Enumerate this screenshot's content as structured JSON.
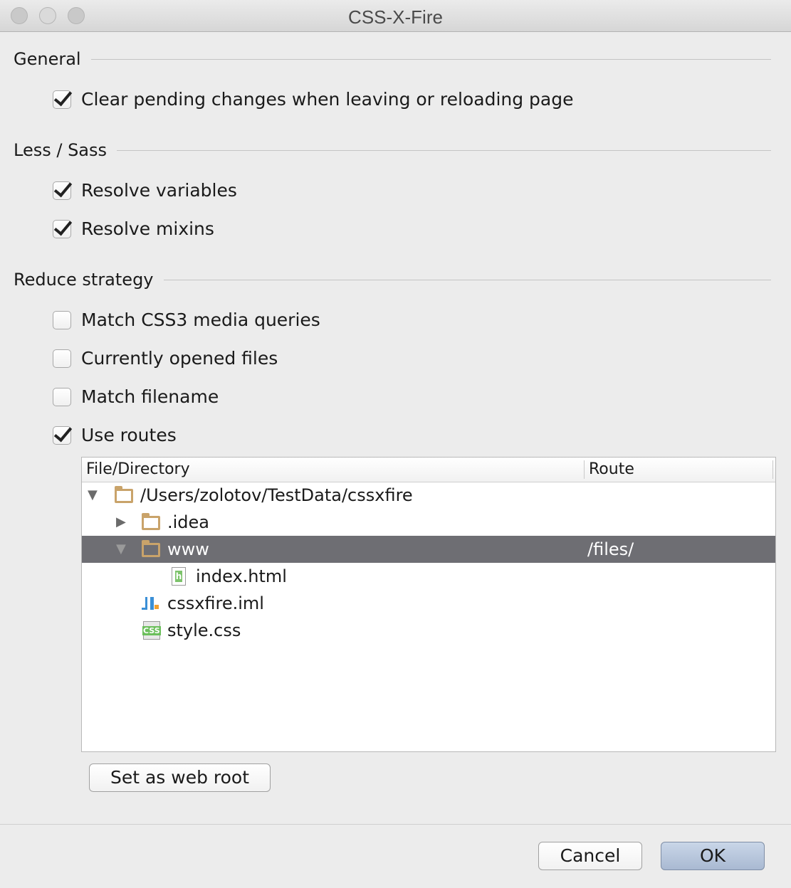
{
  "window": {
    "title": "CSS-X-Fire"
  },
  "sections": {
    "general": "General",
    "less_sass": "Less / Sass",
    "reduce": "Reduce strategy"
  },
  "options": {
    "clear_pending": {
      "label": "Clear pending changes when leaving or reloading page",
      "checked": true
    },
    "resolve_variables": {
      "label": "Resolve variables",
      "checked": true
    },
    "resolve_mixins": {
      "label": "Resolve mixins",
      "checked": true
    },
    "match_media": {
      "label": "Match CSS3 media queries",
      "checked": false
    },
    "opened_files": {
      "label": "Currently opened files",
      "checked": false
    },
    "match_filename": {
      "label": "Match filename",
      "checked": false
    },
    "use_routes": {
      "label": "Use routes",
      "checked": true
    }
  },
  "routes_table": {
    "columns": [
      "File/Directory",
      "Route"
    ],
    "rows": [
      {
        "name": "/Users/zolotov/TestData/cssxfire",
        "route": "",
        "icon": "folder-icon",
        "expanded": true
      },
      {
        "name": ".idea",
        "route": "",
        "icon": "folder-icon",
        "expanded": false
      },
      {
        "name": "www",
        "route": "/files/",
        "icon": "folder-icon",
        "expanded": true,
        "selected": true
      },
      {
        "name": "index.html",
        "route": "",
        "icon": "html-file-icon"
      },
      {
        "name": "cssxfire.iml",
        "route": "",
        "icon": "iml-file-icon"
      },
      {
        "name": "style.css",
        "route": "",
        "icon": "css-file-icon"
      }
    ]
  },
  "buttons": {
    "set_web_root": "Set as web root",
    "cancel": "Cancel",
    "ok": "OK"
  }
}
